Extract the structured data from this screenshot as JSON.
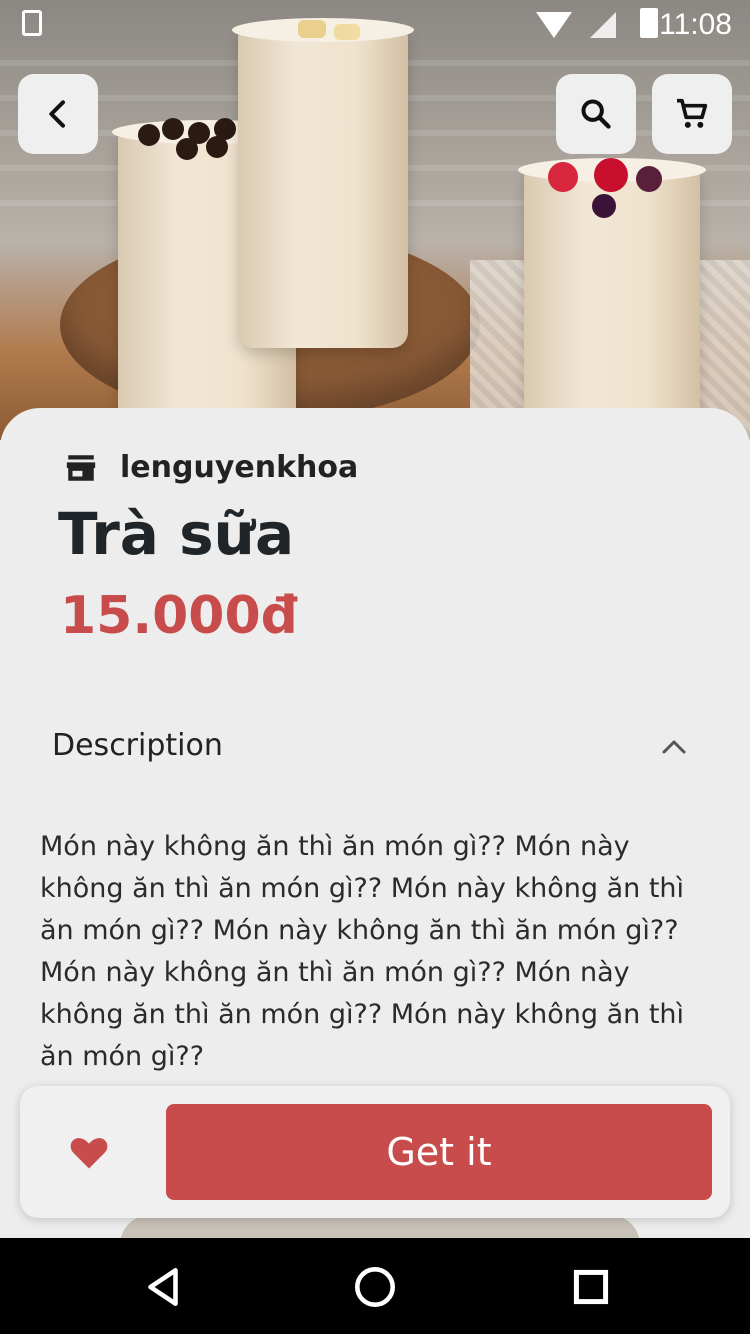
{
  "status_bar": {
    "time": "11:08"
  },
  "icons": {
    "back": "arrow-left",
    "search": "search",
    "cart": "shopping-cart",
    "shop": "store",
    "chevron": "chevron-up",
    "favorite": "heart",
    "nav_back": "triangle-back",
    "nav_home": "circle-home",
    "nav_recent": "square-recent"
  },
  "product": {
    "shop_name": "lenguyenkhoa",
    "title": "Trà sữa",
    "price": "15.000đ"
  },
  "description": {
    "header": "Description",
    "text": "Món này không ăn thì ăn món gì?? Món này không ăn thì ăn món gì?? Món này không ăn thì ăn món gì?? Món này không ăn thì ăn món gì?? Món này không ăn thì ăn món gì?? Món này không ăn thì ăn món gì?? Món này không ăn thì ăn món gì??"
  },
  "actions": {
    "get_label": "Get it"
  },
  "colors": {
    "accent": "#c94c4c",
    "background": "#ededed"
  }
}
